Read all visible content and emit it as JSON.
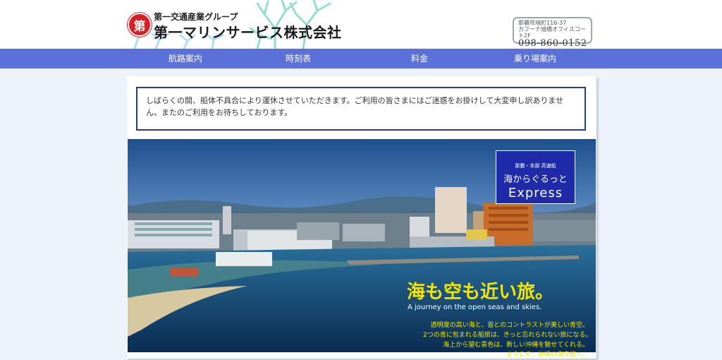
{
  "header": {
    "group_name": "第一交通産業グループ",
    "company_name": "第一マリンサービス株式会社",
    "logo_char": "第",
    "address_line1": "那覇市旭町116-37",
    "address_line2": "カフーナ旭橋オフィスコート2F",
    "phone": "098-860-0152"
  },
  "nav": {
    "items": [
      "航路案内",
      "時刻表",
      "料金",
      "乗り場案内"
    ]
  },
  "notice": {
    "text": "しばらくの間、船体不具合により運休させていただきます。ご利用の皆さまにはご迷惑をお掛けして大変申し訳ありません。またのご利用をお待ちしております。"
  },
  "badge": {
    "subtitle": "那覇・本部 高速船",
    "title": "海からぐるっと",
    "express": "Express"
  },
  "hero": {
    "catch": "海も空も近い旅。",
    "catch_en": "A journey on the open seas and skies.",
    "desc_lines": [
      "透明度の高い海と、雲とのコントラストが美しい青空。",
      "2つの青に包まれる船旅は、きっと忘れられない旅になる。",
      "海上から望む景色は、新しい沖縄を魅せてくれる。",
      "ようこそ、沖縄の海空旅へ。"
    ]
  },
  "colors": {
    "nav_bg": "#5b71d9",
    "notice_border": "#2a3a8f",
    "logo_red": "#d81f26",
    "catch_yellow": "#f2e600",
    "badge_bg": "#1f2aa8"
  }
}
